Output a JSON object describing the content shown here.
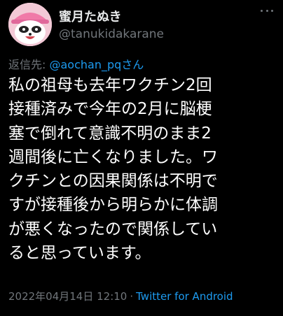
{
  "author": {
    "display_name": "蜜月たぬき",
    "handle": "@tanukidakarane",
    "avatar_icon": "raccoon-avatar-icon"
  },
  "reply": {
    "prefix": "返信先: ",
    "mention": "@aochan_pq",
    "suffix": "さん"
  },
  "tweet": {
    "lines": [
      "私の祖母も去年ワクチン2回",
      "接種済みで今年の2月に脳梗",
      "塞で倒れて意識不明のまま2",
      "週間後に亡くなりました。ワ",
      "クチンとの因果関係は不明で",
      "すが接種後から明らかに体調",
      "が悪くなったので関係してい",
      "ると思っています。"
    ]
  },
  "meta": {
    "timestamp": "2022年04月14日 12:10",
    "separator": "·",
    "source": "Twitter for Android"
  },
  "colors": {
    "background": "#000000",
    "text": "#ffffff",
    "muted": "#71767b",
    "link": "#1d9bf0"
  }
}
